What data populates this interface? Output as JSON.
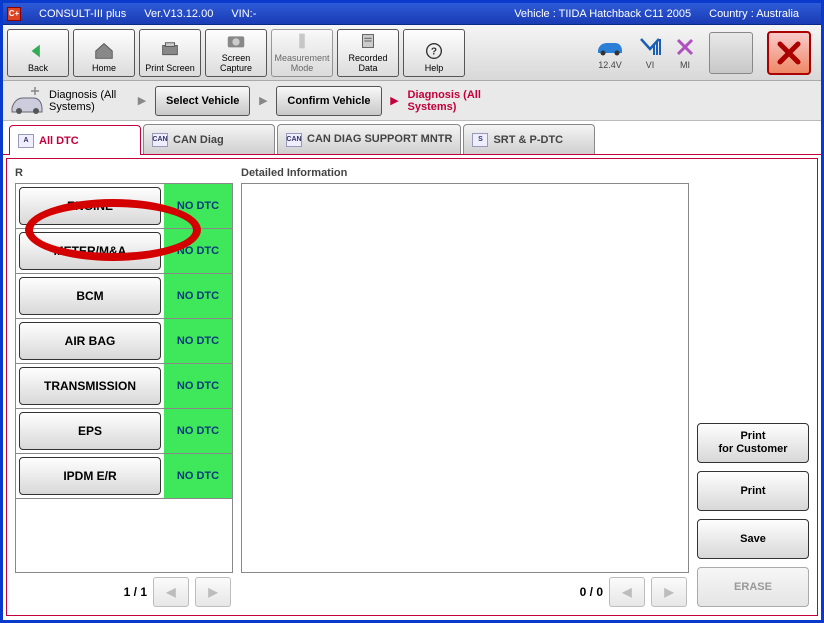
{
  "titlebar": {
    "app": "CONSULT-III plus",
    "version": "Ver.V13.12.00",
    "vin_label": "VIN:-",
    "vehicle_label": "Vehicle : TIIDA Hatchback C11 2005",
    "country_label": "Country : Australia"
  },
  "toolbar": {
    "back": "Back",
    "home": "Home",
    "print_screen": "Print Screen",
    "screen_capture": "Screen\nCapture",
    "measurement_mode": "Measurement\nMode",
    "recorded_data": "Recorded\nData",
    "help": "Help"
  },
  "status": {
    "voltage": "12.4V",
    "vi": "VI",
    "mi": "MI"
  },
  "breadcrumb": {
    "start": "Diagnosis (All Systems)",
    "step1": "Select Vehicle",
    "step2": "Confirm Vehicle",
    "current": "Diagnosis (All Systems)"
  },
  "tabs": [
    {
      "label": "All DTC",
      "active": true
    },
    {
      "label": "CAN Diag",
      "active": false
    },
    {
      "label": "CAN DIAG SUPPORT MNTR",
      "active": false
    },
    {
      "label": "SRT & P-DTC",
      "active": false
    }
  ],
  "left": {
    "header": "R",
    "pager": "1 / 1",
    "systems": [
      {
        "name": "ENGINE",
        "status": "NO DTC"
      },
      {
        "name": "METER/M&A",
        "status": "NO DTC"
      },
      {
        "name": "BCM",
        "status": "NO DTC"
      },
      {
        "name": "AIR BAG",
        "status": "NO DTC"
      },
      {
        "name": "TRANSMISSION",
        "status": "NO DTC"
      },
      {
        "name": "EPS",
        "status": "NO DTC"
      },
      {
        "name": "IPDM E/R",
        "status": "NO DTC"
      }
    ]
  },
  "detail": {
    "header": "Detailed Information",
    "pager": "0 / 0"
  },
  "actions": {
    "print_customer": "Print\nfor Customer",
    "print": "Print",
    "save": "Save",
    "erase": "ERASE"
  }
}
